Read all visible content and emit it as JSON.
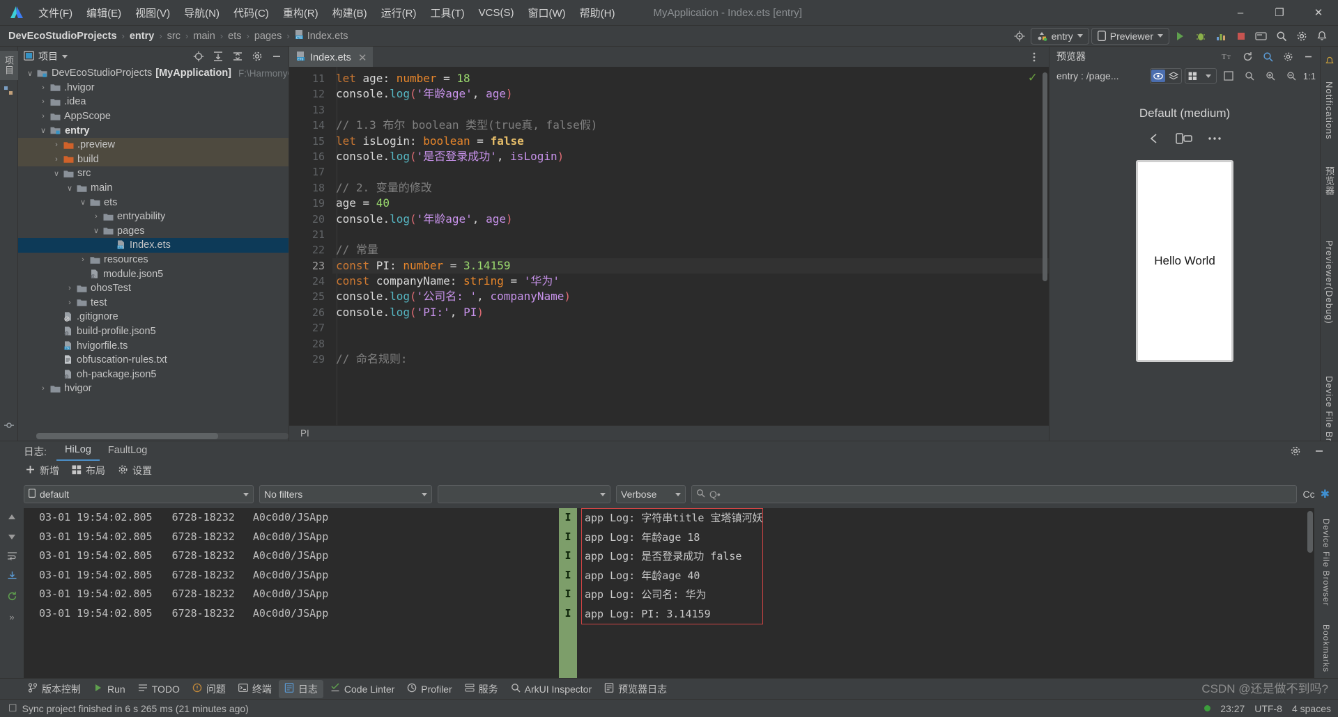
{
  "window": {
    "title": "MyApplication - Index.ets [entry]",
    "minimize": "–",
    "maximize": "❐",
    "close": "✕"
  },
  "menu": {
    "items": [
      {
        "label": "文件(F)"
      },
      {
        "label": "编辑(E)"
      },
      {
        "label": "视图(V)"
      },
      {
        "label": "导航(N)"
      },
      {
        "label": "代码(C)"
      },
      {
        "label": "重构(R)"
      },
      {
        "label": "构建(B)"
      },
      {
        "label": "运行(R)"
      },
      {
        "label": "工具(T)"
      },
      {
        "label": "VCS(S)"
      },
      {
        "label": "窗口(W)"
      },
      {
        "label": "帮助(H)"
      }
    ]
  },
  "breadcrumb": {
    "items": [
      "DevEcoStudioProjects",
      "entry",
      "src",
      "main",
      "ets",
      "pages",
      "Index.ets"
    ],
    "separator": "›"
  },
  "toolbar": {
    "run_config": "entry",
    "device": "Previewer",
    "icons": [
      "target-icon",
      "sync-icon",
      "debug-icon",
      "profile-icon",
      "stop-icon",
      "device-manager-icon",
      "search-icon",
      "settings-icon",
      "notifications-icon"
    ]
  },
  "project": {
    "panel_title": "项目",
    "tree": [
      {
        "indent": 0,
        "arrow": "∨",
        "icon": "project-folder",
        "label": "DevEcoStudioProjects",
        "bold_label": "[MyApplication]",
        "path": "F:\\HarmonyOSNE›",
        "state": "normal"
      },
      {
        "indent": 1,
        "arrow": "›",
        "icon": "folder",
        "label": ".hvigor",
        "state": "normal"
      },
      {
        "indent": 1,
        "arrow": "›",
        "icon": "folder",
        "label": ".idea",
        "state": "normal"
      },
      {
        "indent": 1,
        "arrow": "›",
        "icon": "folder",
        "label": "AppScope",
        "state": "normal"
      },
      {
        "indent": 1,
        "arrow": "∨",
        "icon": "module-folder",
        "label": "entry",
        "bold": true,
        "state": "normal"
      },
      {
        "indent": 2,
        "arrow": "›",
        "icon": "folder-orange",
        "label": ".preview",
        "state": "excluded"
      },
      {
        "indent": 2,
        "arrow": "›",
        "icon": "folder-orange",
        "label": "build",
        "state": "excluded"
      },
      {
        "indent": 2,
        "arrow": "∨",
        "icon": "folder",
        "label": "src",
        "state": "normal"
      },
      {
        "indent": 3,
        "arrow": "∨",
        "icon": "folder",
        "label": "main",
        "state": "normal"
      },
      {
        "indent": 4,
        "arrow": "∨",
        "icon": "folder",
        "label": "ets",
        "state": "normal"
      },
      {
        "indent": 5,
        "arrow": "›",
        "icon": "folder",
        "label": "entryability",
        "state": "normal"
      },
      {
        "indent": 5,
        "arrow": "∨",
        "icon": "folder",
        "label": "pages",
        "state": "normal"
      },
      {
        "indent": 6,
        "arrow": "",
        "icon": "ets-file",
        "label": "Index.ets",
        "state": "selected"
      },
      {
        "indent": 4,
        "arrow": "›",
        "icon": "folder",
        "label": "resources",
        "state": "normal"
      },
      {
        "indent": 4,
        "arrow": "",
        "icon": "json5-file",
        "label": "module.json5",
        "state": "normal"
      },
      {
        "indent": 3,
        "arrow": "›",
        "icon": "folder",
        "label": "ohosTest",
        "state": "normal"
      },
      {
        "indent": 3,
        "arrow": "›",
        "icon": "folder",
        "label": "test",
        "state": "normal"
      },
      {
        "indent": 2,
        "arrow": "",
        "icon": "gitignore-file",
        "label": ".gitignore",
        "state": "normal"
      },
      {
        "indent": 2,
        "arrow": "",
        "icon": "json5-file",
        "label": "build-profile.json5",
        "state": "normal"
      },
      {
        "indent": 2,
        "arrow": "",
        "icon": "ts-file",
        "label": "hvigorfile.ts",
        "state": "normal"
      },
      {
        "indent": 2,
        "arrow": "",
        "icon": "txt-file",
        "label": "obfuscation-rules.txt",
        "state": "normal"
      },
      {
        "indent": 2,
        "arrow": "",
        "icon": "json5-file",
        "label": "oh-package.json5",
        "state": "normal"
      },
      {
        "indent": 1,
        "arrow": "›",
        "icon": "folder",
        "label": "hvigor",
        "state": "normal"
      }
    ]
  },
  "editor": {
    "tab": {
      "label": "Index.ets",
      "close": "✕"
    },
    "footer_breadcrumb": "PI",
    "first_line_number": 11,
    "current_line": 23,
    "lines": [
      {
        "n": 11,
        "tokens": [
          [
            "kw",
            "let "
          ],
          [
            "pl",
            "age"
          ],
          [
            "pl",
            ": "
          ],
          [
            "typ",
            "number"
          ],
          [
            "pl",
            " = "
          ],
          [
            "num",
            "18"
          ]
        ]
      },
      {
        "n": 12,
        "tokens": [
          [
            "pl",
            "console"
          ],
          [
            "pl",
            "."
          ],
          [
            "fn",
            "log"
          ],
          [
            "pn",
            "("
          ],
          [
            "str",
            "'年龄age'"
          ],
          [
            "pl",
            ", "
          ],
          [
            "vr",
            "age"
          ],
          [
            "pn",
            ")"
          ]
        ]
      },
      {
        "n": 13,
        "tokens": [
          [
            "pl",
            ""
          ]
        ]
      },
      {
        "n": 14,
        "tokens": [
          [
            "cm",
            "// 1.3 布尔 boolean 类型(true真, false假)"
          ]
        ]
      },
      {
        "n": 15,
        "tokens": [
          [
            "kw",
            "let "
          ],
          [
            "pl",
            "isLogin"
          ],
          [
            "pl",
            ": "
          ],
          [
            "typ",
            "boolean"
          ],
          [
            "pl",
            " = "
          ],
          [
            "kw2",
            "false"
          ]
        ]
      },
      {
        "n": 16,
        "tokens": [
          [
            "pl",
            "console"
          ],
          [
            "pl",
            "."
          ],
          [
            "fn",
            "log"
          ],
          [
            "pn",
            "("
          ],
          [
            "str",
            "'是否登录成功'"
          ],
          [
            "pl",
            ", "
          ],
          [
            "vr",
            "isLogin"
          ],
          [
            "pn",
            ")"
          ]
        ]
      },
      {
        "n": 17,
        "tokens": [
          [
            "pl",
            ""
          ]
        ]
      },
      {
        "n": 18,
        "tokens": [
          [
            "cm",
            "// 2. 变量的修改"
          ]
        ]
      },
      {
        "n": 19,
        "tokens": [
          [
            "pl",
            "age = "
          ],
          [
            "num",
            "40"
          ]
        ]
      },
      {
        "n": 20,
        "tokens": [
          [
            "pl",
            "console"
          ],
          [
            "pl",
            "."
          ],
          [
            "fn",
            "log"
          ],
          [
            "pn",
            "("
          ],
          [
            "str",
            "'年龄age'"
          ],
          [
            "pl",
            ", "
          ],
          [
            "vr",
            "age"
          ],
          [
            "pn",
            ")"
          ]
        ]
      },
      {
        "n": 21,
        "tokens": [
          [
            "pl",
            ""
          ]
        ]
      },
      {
        "n": 22,
        "tokens": [
          [
            "cm",
            "// 常量"
          ]
        ]
      },
      {
        "n": 23,
        "tokens": [
          [
            "kw",
            "const "
          ],
          [
            "pl",
            "PI"
          ],
          [
            "pl",
            ": "
          ],
          [
            "typ",
            "number"
          ],
          [
            "pl",
            " = "
          ],
          [
            "num",
            "3.14159"
          ]
        ]
      },
      {
        "n": 24,
        "tokens": [
          [
            "kw",
            "const "
          ],
          [
            "pl",
            "companyName"
          ],
          [
            "pl",
            ": "
          ],
          [
            "typ",
            "string"
          ],
          [
            "pl",
            " = "
          ],
          [
            "str",
            "'华为'"
          ]
        ]
      },
      {
        "n": 25,
        "tokens": [
          [
            "pl",
            "console"
          ],
          [
            "pl",
            "."
          ],
          [
            "fn",
            "log"
          ],
          [
            "pn",
            "("
          ],
          [
            "str",
            "'公司名: '"
          ],
          [
            "pl",
            ", "
          ],
          [
            "vr",
            "companyName"
          ],
          [
            "pn",
            ")"
          ]
        ]
      },
      {
        "n": 26,
        "tokens": [
          [
            "pl",
            "console"
          ],
          [
            "pl",
            "."
          ],
          [
            "fn",
            "log"
          ],
          [
            "pn",
            "("
          ],
          [
            "str",
            "'PI:'"
          ],
          [
            "pl",
            ", "
          ],
          [
            "vr",
            "PI"
          ],
          [
            "pn",
            ")"
          ]
        ]
      },
      {
        "n": 27,
        "tokens": [
          [
            "pl",
            ""
          ]
        ]
      },
      {
        "n": 28,
        "tokens": [
          [
            "pl",
            ""
          ]
        ]
      },
      {
        "n": 29,
        "tokens": [
          [
            "cm",
            "// 命名规则:"
          ]
        ]
      }
    ],
    "inspection_ok": "✓"
  },
  "previewer": {
    "panel_title": "预览器",
    "path_label": "entry : /page...",
    "device_label": "Default (medium)",
    "phone_text": "Hello World",
    "zoom_label": "1:1",
    "controls": [
      "back-icon",
      "rotate-icon",
      "more-icon"
    ]
  },
  "rails": {
    "left": [
      "项目",
      "结构"
    ],
    "right": [
      "Notifications",
      "预览器",
      "Previewer(Debug)",
      "Device File Browser",
      "Bookmarks"
    ]
  },
  "log": {
    "group_label": "日志:",
    "tabs": [
      {
        "label": "HiLog",
        "selected": true
      },
      {
        "label": "FaultLog",
        "selected": false
      }
    ],
    "actions": [
      {
        "icon": "plus-icon",
        "label": "新增"
      },
      {
        "icon": "layout-icon",
        "label": "布局"
      },
      {
        "icon": "gear-icon",
        "label": "设置"
      }
    ],
    "filters": {
      "device": "default",
      "process": "No filters",
      "blank": "",
      "level": "Verbose",
      "search_placeholder": "Q•",
      "case_label": "Cc",
      "regex_label": "✱"
    },
    "columns": [
      "time",
      "pid",
      "tag",
      "level",
      "message"
    ],
    "rows": [
      {
        "time": "03-01 19:54:02.805",
        "pid": "6728-18232",
        "tag": "A0c0d0/JSApp",
        "level": "I",
        "message": "app Log: 字符串title 宝塔镇河妖"
      },
      {
        "time": "03-01 19:54:02.805",
        "pid": "6728-18232",
        "tag": "A0c0d0/JSApp",
        "level": "I",
        "message": "app Log: 年龄age 18"
      },
      {
        "time": "03-01 19:54:02.805",
        "pid": "6728-18232",
        "tag": "A0c0d0/JSApp",
        "level": "I",
        "message": "app Log: 是否登录成功 false"
      },
      {
        "time": "03-01 19:54:02.805",
        "pid": "6728-18232",
        "tag": "A0c0d0/JSApp",
        "level": "I",
        "message": "app Log: 年龄age 40"
      },
      {
        "time": "03-01 19:54:02.805",
        "pid": "6728-18232",
        "tag": "A0c0d0/JSApp",
        "level": "I",
        "message": "app Log: 公司名: 华为"
      },
      {
        "time": "03-01 19:54:02.805",
        "pid": "6728-18232",
        "tag": "A0c0d0/JSApp",
        "level": "I",
        "message": "app Log: PI: 3.14159"
      }
    ],
    "highlight_color": "#d14545"
  },
  "toolwindows": [
    {
      "icon": "branch-icon",
      "label": "版本控制",
      "selected": false
    },
    {
      "icon": "run-icon",
      "label": "Run",
      "selected": false
    },
    {
      "icon": "todo-icon",
      "label": "TODO",
      "selected": false
    },
    {
      "icon": "problems-icon",
      "label": "问题",
      "selected": false
    },
    {
      "icon": "terminal-icon",
      "label": "终端",
      "selected": false
    },
    {
      "icon": "log-icon",
      "label": "日志",
      "selected": true
    },
    {
      "icon": "linter-icon",
      "label": "Code Linter",
      "selected": false
    },
    {
      "icon": "profiler-icon",
      "label": "Profiler",
      "selected": false
    },
    {
      "icon": "service-icon",
      "label": "服务",
      "selected": false
    },
    {
      "icon": "inspector-icon",
      "label": "ArkUI Inspector",
      "selected": false
    },
    {
      "icon": "preview-log-icon",
      "label": "预览器日志",
      "selected": false
    }
  ],
  "status": {
    "message": "Sync project finished in 6 s 265 ms (21 minutes ago)",
    "time": "23:27",
    "encoding": "UTF-8",
    "indent": "4 spaces",
    "checkbox": "☐"
  },
  "watermark": "CSDN @还是做不到吗?"
}
